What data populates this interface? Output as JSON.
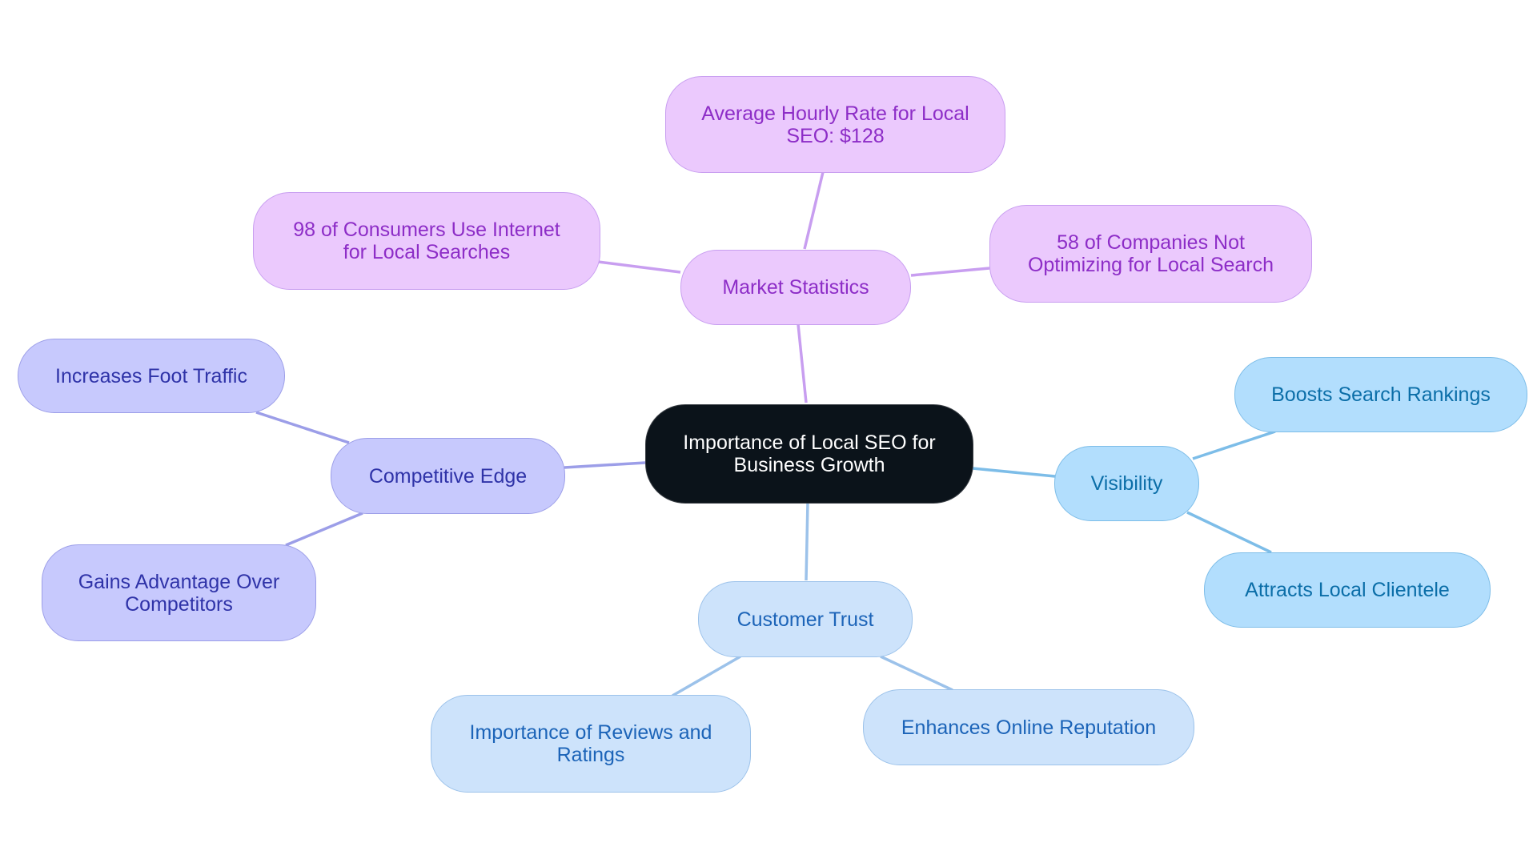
{
  "diagram": {
    "title": "Importance of Local SEO for Business Growth",
    "colors": {
      "root_bg": "#0b131a",
      "root_text": "#ffffff",
      "market_bg": "#ebc9fd",
      "market_text": "#8d2dc7",
      "market_edge": "#c89ef0",
      "competitive_bg": "#c7c9fd",
      "competitive_text": "#2f33a8",
      "competitive_edge": "#9c9ee8",
      "visibility_bg": "#b2defd",
      "visibility_text": "#0b6ea8",
      "visibility_edge": "#7dbde8",
      "trust_bg": "#cde3fb",
      "trust_text": "#1c64b8",
      "trust_edge": "#9cc2ea"
    },
    "root": {
      "line1": "Importance of Local SEO for",
      "line2": "Business Growth"
    },
    "branches": {
      "market": {
        "label": "Market Statistics",
        "children": [
          {
            "line1": "Average Hourly Rate for Local",
            "line2": "SEO: $128"
          },
          {
            "line1": "98 of Consumers Use Internet",
            "line2": "for Local Searches"
          },
          {
            "line1": "58 of Companies Not",
            "line2": "Optimizing for Local Search"
          }
        ]
      },
      "competitive": {
        "label": "Competitive Edge",
        "children": [
          {
            "line1": "Increases Foot Traffic"
          },
          {
            "line1": "Gains Advantage Over",
            "line2": "Competitors"
          }
        ]
      },
      "visibility": {
        "label": "Visibility",
        "children": [
          {
            "line1": "Boosts Search Rankings"
          },
          {
            "line1": "Attracts Local Clientele"
          }
        ]
      },
      "trust": {
        "label": "Customer Trust",
        "children": [
          {
            "line1": "Importance of Reviews and",
            "line2": "Ratings"
          },
          {
            "line1": "Enhances Online Reputation"
          }
        ]
      }
    }
  }
}
